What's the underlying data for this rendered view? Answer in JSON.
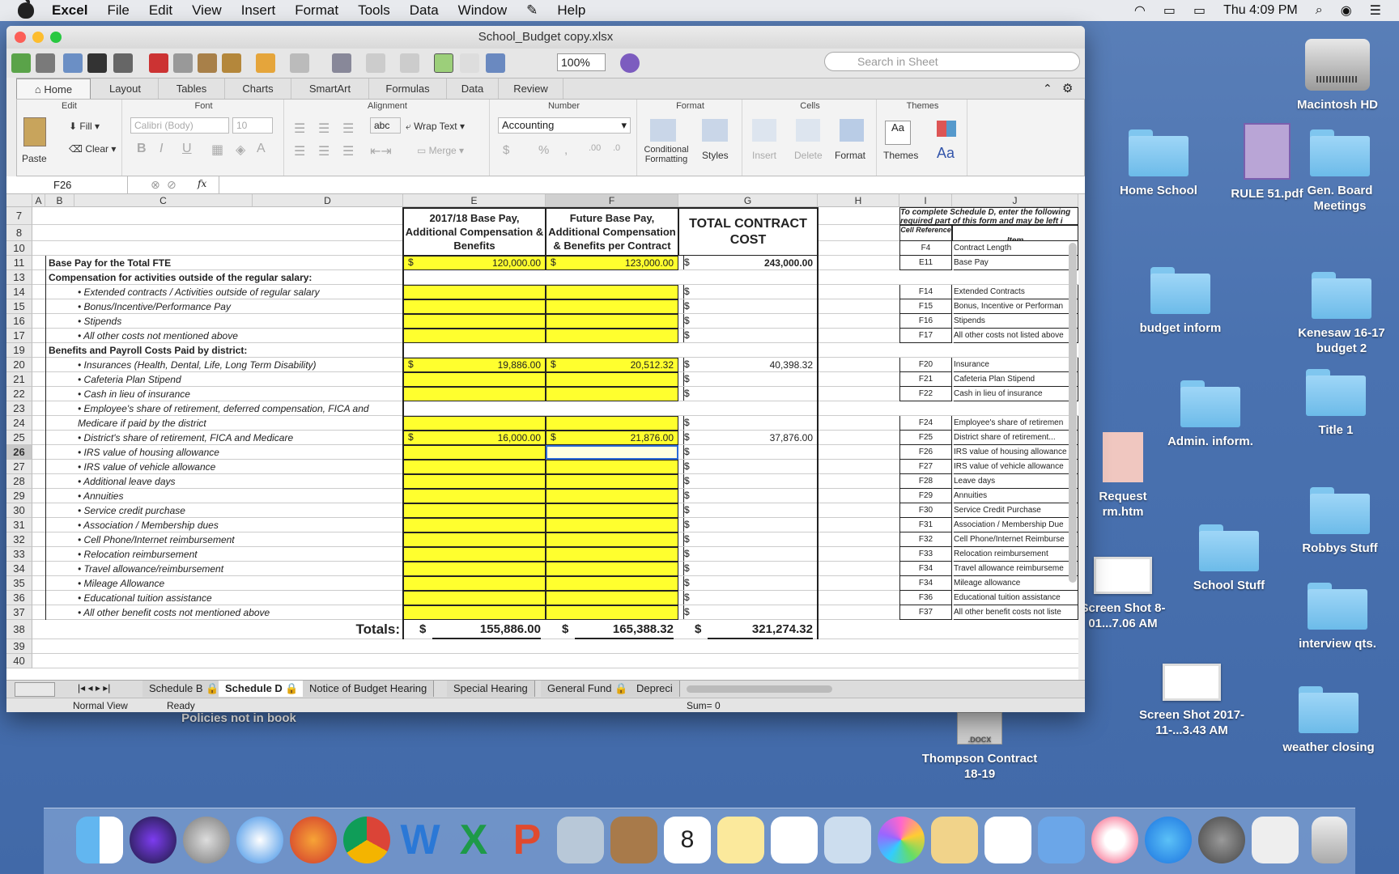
{
  "menubar": {
    "app": "Excel",
    "items": [
      "File",
      "Edit",
      "View",
      "Insert",
      "Format",
      "Tools",
      "Data",
      "Window",
      "Help"
    ],
    "clock": "Thu 4:09 PM"
  },
  "desktop": {
    "icons": [
      "Macintosh HD",
      "Home School",
      "RULE 51.pdf",
      "Gen. Board Meetings",
      "budget inform",
      "Kenesaw 16-17 budget 2",
      "Admin. inform.",
      "Title 1",
      "Request rm.htm",
      "Robbys Stuff",
      "Screen Shot 8-01...7.06 AM",
      "School Stuff",
      "interview qts.",
      "Screen Shot 2017-11-...3.43 AM",
      "weather closing",
      "Thompson Contract 18-19",
      "Policies not in book"
    ]
  },
  "window": {
    "title": "School_Budget copy.xlsx",
    "zoom": "100%",
    "search_placeholder": "Search in Sheet"
  },
  "ribbon": {
    "tabs": [
      "Home",
      "Layout",
      "Tables",
      "Charts",
      "SmartArt",
      "Formulas",
      "Data",
      "Review"
    ],
    "groups": [
      "Edit",
      "Font",
      "Alignment",
      "Number",
      "Format",
      "Cells",
      "Themes"
    ],
    "paste": "Paste",
    "fill": "Fill",
    "clear": "Clear",
    "font": "Calibri (Body)",
    "size": "10",
    "abc": "abc",
    "wrap": "Wrap Text",
    "merge": "Merge",
    "number_format": "Accounting",
    "cond": "Conditional Formatting",
    "styles": "Styles",
    "insert": "Insert",
    "delete": "Delete",
    "format": "Format",
    "themes": "Themes",
    "aa": "Aa"
  },
  "formula": {
    "name_box": "F26",
    "fx": "fx"
  },
  "columns": [
    "A",
    "B",
    "C",
    "D",
    "E",
    "F",
    "G",
    "H",
    "I",
    "J"
  ],
  "headers": {
    "e": "2017/18 Base Pay, Additional Compensation & Benefits",
    "f": "Future Base Pay, Additional Compensation & Benefits per Contract",
    "g": "TOTAL CONTRACT COST",
    "i_note": "To complete Schedule D, enter the following required part of this form and may be left i",
    "cell_ref": "Cell Reference",
    "item": "Item"
  },
  "rows": [
    {
      "n": "7"
    },
    {
      "n": "8"
    },
    {
      "n": "10",
      "iref": "F4",
      "item": "Contract Length"
    },
    {
      "n": "11",
      "c": "Base Pay for the Total FTE",
      "bold": true,
      "e": "120,000.00",
      "f": "123,000.00",
      "g": "243,000.00",
      "iref": "E11",
      "item": "Base Pay",
      "y": true
    },
    {
      "n": "13",
      "c": "Compensation for activities outside of the regular salary:",
      "bold": true
    },
    {
      "n": "14",
      "c": "• Extended contracts / Activities outside of regular salary",
      "iref": "F14",
      "item": "Extended Contracts",
      "y": true
    },
    {
      "n": "15",
      "c": "• Bonus/Incentive/Performance Pay",
      "iref": "F15",
      "item": "Bonus, Incentive or Performan",
      "y": true
    },
    {
      "n": "16",
      "c": "• Stipends",
      "iref": "F16",
      "item": "Stipends",
      "y": true
    },
    {
      "n": "17",
      "c": "• All other costs not mentioned above",
      "iref": "F17",
      "item": "All other costs not listed above",
      "y": true
    },
    {
      "n": "19",
      "c": "Benefits and Payroll Costs Paid by district:",
      "bold": true
    },
    {
      "n": "20",
      "c": "• Insurances (Health, Dental, Life, Long Term Disability)",
      "e": "19,886.00",
      "f": "20,512.32",
      "g": "40,398.32",
      "iref": "F20",
      "item": "Insurance",
      "y": true
    },
    {
      "n": "21",
      "c": "• Cafeteria Plan Stipend",
      "iref": "F21",
      "item": "Cafeteria Plan Stipend",
      "y": true
    },
    {
      "n": "22",
      "c": "• Cash in lieu of insurance",
      "iref": "F22",
      "item": "Cash in lieu of insurance",
      "y": true
    },
    {
      "n": "23",
      "c": "• Employee's share of retirement, deferred compensation, FICA and"
    },
    {
      "n": "24",
      "c": "Medicare if paid by the district",
      "iref": "F24",
      "item": "Employee's share of retiremen",
      "y": true
    },
    {
      "n": "25",
      "c": "• District's share of retirement, FICA and Medicare",
      "e": "16,000.00",
      "f": "21,876.00",
      "g": "37,876.00",
      "iref": "F25",
      "item": "District share of retirement...",
      "y": true
    },
    {
      "n": "26",
      "c": "• IRS value of housing allowance",
      "iref": "F26",
      "item": "IRS value of housing allowance",
      "y": true
    },
    {
      "n": "27",
      "c": "• IRS value of vehicle allowance",
      "iref": "F27",
      "item": "IRS value of vehicle allowance",
      "y": true
    },
    {
      "n": "28",
      "c": "• Additional leave days",
      "iref": "F28",
      "item": "Leave days",
      "y": true
    },
    {
      "n": "29",
      "c": "• Annuities",
      "iref": "F29",
      "item": "Annuities",
      "y": true
    },
    {
      "n": "30",
      "c": "• Service credit purchase",
      "iref": "F30",
      "item": "Service Credit Purchase",
      "y": true
    },
    {
      "n": "31",
      "c": "• Association / Membership dues",
      "iref": "F31",
      "item": "Association / Membership Due",
      "y": true
    },
    {
      "n": "32",
      "c": "• Cell Phone/Internet reimbursement",
      "iref": "F32",
      "item": "Cell Phone/Internet Reimburse",
      "y": true
    },
    {
      "n": "33",
      "c": "• Relocation reimbursement",
      "iref": "F33",
      "item": "Relocation reimbursement",
      "y": true
    },
    {
      "n": "34",
      "c": "• Travel allowance/reimbursement",
      "iref": "F34",
      "item": "Travel allowance reimburseme",
      "y": true
    },
    {
      "n": "35",
      "c": "• Mileage Allowance",
      "iref": "F34",
      "item": "Mileage allowance",
      "y": true
    },
    {
      "n": "36",
      "c": "• Educational tuition assistance",
      "iref": "F36",
      "item": "Educational tuition assistance",
      "y": true
    },
    {
      "n": "37",
      "c": "• All other benefit costs not mentioned above",
      "iref": "F37",
      "item": "All other benefit costs not liste",
      "y": true
    },
    {
      "n": "38",
      "totals": true
    },
    {
      "n": "39"
    },
    {
      "n": "40"
    }
  ],
  "totals": {
    "label": "Totals:",
    "e": "155,886.00",
    "f": "165,388.32",
    "g": "321,274.32",
    "cur": "$"
  },
  "sheet_tabs": [
    "Schedule B",
    "Schedule D",
    "Notice of Budget Hearing",
    "Special Hearing",
    "General Fund",
    "Depreci"
  ],
  "status": {
    "view": "Normal View",
    "mode": "Ready",
    "sum": "Sum= 0"
  }
}
